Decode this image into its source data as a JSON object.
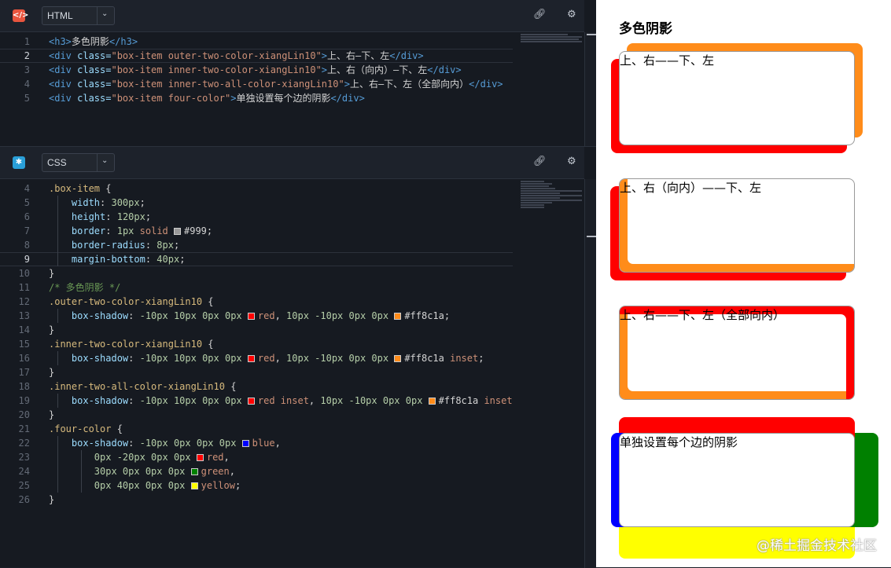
{
  "html_pane": {
    "logo": "</>",
    "language": "HTML",
    "active_line": 2,
    "lines": [
      {
        "n": "1",
        "parts": [
          [
            "tag",
            "<h3>"
          ],
          [
            "plain",
            "多色阴影"
          ],
          [
            "tag",
            "</h3>"
          ]
        ]
      },
      {
        "n": "2",
        "parts": [
          [
            "tag",
            "<div "
          ],
          [
            "attr",
            "class="
          ],
          [
            "str",
            "\"box-item outer-two-color-xiangLin10\""
          ],
          [
            "tag",
            ">"
          ],
          [
            "plain",
            "上、右—下、左"
          ],
          [
            "tag",
            "</div>"
          ]
        ]
      },
      {
        "n": "3",
        "parts": [
          [
            "tag",
            "<div "
          ],
          [
            "attr",
            "class="
          ],
          [
            "str",
            "\"box-item inner-two-color-xiangLin10\""
          ],
          [
            "tag",
            ">"
          ],
          [
            "plain",
            "上、右（向内）—下、左"
          ],
          [
            "tag",
            "</div>"
          ]
        ]
      },
      {
        "n": "4",
        "parts": [
          [
            "tag",
            "<div "
          ],
          [
            "attr",
            "class="
          ],
          [
            "str",
            "\"box-item inner-two-all-color-xiangLin10\""
          ],
          [
            "tag",
            ">"
          ],
          [
            "plain",
            "上、右—下、左（全部向内）"
          ],
          [
            "tag",
            "</div>"
          ]
        ]
      },
      {
        "n": "5",
        "parts": [
          [
            "tag",
            "<div "
          ],
          [
            "attr",
            "class="
          ],
          [
            "str",
            "\"box-item four-color\""
          ],
          [
            "tag",
            ">"
          ],
          [
            "plain",
            "单独设置每个边的阴影"
          ],
          [
            "tag",
            "</div>"
          ]
        ]
      }
    ]
  },
  "css_pane": {
    "logo": "✱",
    "language": "CSS",
    "active_line": 9,
    "lines": [
      {
        "n": "4",
        "parts": [
          [
            "sel",
            ".box-item"
          ],
          [
            "plain",
            " {"
          ]
        ]
      },
      {
        "n": "5",
        "parts": [
          [
            "plain",
            "    "
          ],
          [
            "prop",
            "width"
          ],
          [
            "plain",
            ": "
          ],
          [
            "num",
            "300px"
          ],
          [
            "plain",
            ";"
          ]
        ]
      },
      {
        "n": "6",
        "parts": [
          [
            "plain",
            "    "
          ],
          [
            "prop",
            "height"
          ],
          [
            "plain",
            ": "
          ],
          [
            "num",
            "120px"
          ],
          [
            "plain",
            ";"
          ]
        ]
      },
      {
        "n": "7",
        "parts": [
          [
            "plain",
            "    "
          ],
          [
            "prop",
            "border"
          ],
          [
            "plain",
            ": "
          ],
          [
            "num",
            "1px"
          ],
          [
            "plain",
            " "
          ],
          [
            "kw",
            "solid"
          ],
          [
            "plain",
            " "
          ],
          [
            "sw",
            "#999999"
          ],
          [
            "plain",
            "#999;"
          ]
        ]
      },
      {
        "n": "8",
        "parts": [
          [
            "plain",
            "    "
          ],
          [
            "prop",
            "border-radius"
          ],
          [
            "plain",
            ": "
          ],
          [
            "num",
            "8px"
          ],
          [
            "plain",
            ";"
          ]
        ]
      },
      {
        "n": "9",
        "parts": [
          [
            "plain",
            "    "
          ],
          [
            "prop",
            "margin-bottom"
          ],
          [
            "plain",
            ": "
          ],
          [
            "num",
            "40px"
          ],
          [
            "plain",
            ";"
          ]
        ]
      },
      {
        "n": "10",
        "parts": [
          [
            "plain",
            "}"
          ]
        ]
      },
      {
        "n": "11",
        "parts": [
          [
            "cmt",
            "/* 多色阴影 */"
          ]
        ]
      },
      {
        "n": "12",
        "parts": [
          [
            "sel",
            ".outer-two-color-xiangLin10"
          ],
          [
            "plain",
            " {"
          ]
        ]
      },
      {
        "n": "13",
        "parts": [
          [
            "plain",
            "    "
          ],
          [
            "prop",
            "box-shadow"
          ],
          [
            "plain",
            ": "
          ],
          [
            "num",
            "-10px 10px 0px 0px"
          ],
          [
            "plain",
            " "
          ],
          [
            "sw",
            "#ff0000"
          ],
          [
            "kw",
            "red"
          ],
          [
            "plain",
            ", "
          ],
          [
            "num",
            "10px -10px 0px 0px"
          ],
          [
            "plain",
            " "
          ],
          [
            "sw",
            "#ff8c1a"
          ],
          [
            "plain",
            "#ff8c1a;"
          ]
        ]
      },
      {
        "n": "14",
        "parts": [
          [
            "plain",
            "}"
          ]
        ]
      },
      {
        "n": "15",
        "parts": [
          [
            "sel",
            ".inner-two-color-xiangLin10"
          ],
          [
            "plain",
            " {"
          ]
        ]
      },
      {
        "n": "16",
        "parts": [
          [
            "plain",
            "    "
          ],
          [
            "prop",
            "box-shadow"
          ],
          [
            "plain",
            ": "
          ],
          [
            "num",
            "-10px 10px 0px 0px"
          ],
          [
            "plain",
            " "
          ],
          [
            "sw",
            "#ff0000"
          ],
          [
            "kw",
            "red"
          ],
          [
            "plain",
            ", "
          ],
          [
            "num",
            "10px -10px 0px 0px"
          ],
          [
            "plain",
            " "
          ],
          [
            "sw",
            "#ff8c1a"
          ],
          [
            "plain",
            "#ff8c1a "
          ],
          [
            "kw",
            "inset"
          ],
          [
            "plain",
            ";"
          ]
        ]
      },
      {
        "n": "17",
        "parts": [
          [
            "plain",
            "}"
          ]
        ]
      },
      {
        "n": "18",
        "parts": [
          [
            "sel",
            ".inner-two-all-color-xiangLin10"
          ],
          [
            "plain",
            " {"
          ]
        ]
      },
      {
        "n": "19",
        "parts": [
          [
            "plain",
            "    "
          ],
          [
            "prop",
            "box-shadow"
          ],
          [
            "plain",
            ": "
          ],
          [
            "num",
            "-10px 10px 0px 0px"
          ],
          [
            "plain",
            " "
          ],
          [
            "sw",
            "#ff0000"
          ],
          [
            "kw",
            "red inset"
          ],
          [
            "plain",
            ", "
          ],
          [
            "num",
            "10px -10px 0px 0px"
          ],
          [
            "plain",
            " "
          ],
          [
            "sw",
            "#ff8c1a"
          ],
          [
            "plain",
            "#ff8c1a "
          ],
          [
            "kw",
            "inset"
          ]
        ]
      },
      {
        "n": "20",
        "parts": [
          [
            "plain",
            "}"
          ]
        ]
      },
      {
        "n": "21",
        "parts": [
          [
            "sel",
            ".four-color"
          ],
          [
            "plain",
            " {"
          ]
        ]
      },
      {
        "n": "22",
        "parts": [
          [
            "plain",
            "    "
          ],
          [
            "prop",
            "box-shadow"
          ],
          [
            "plain",
            ": "
          ],
          [
            "num",
            "-10px 0px 0px 0px"
          ],
          [
            "plain",
            " "
          ],
          [
            "sw",
            "#0000ff"
          ],
          [
            "kw",
            "blue"
          ],
          [
            "plain",
            ","
          ]
        ]
      },
      {
        "n": "23",
        "parts": [
          [
            "plain",
            "        "
          ],
          [
            "num",
            "0px -20px 0px 0px"
          ],
          [
            "plain",
            " "
          ],
          [
            "sw",
            "#ff0000"
          ],
          [
            "kw",
            "red"
          ],
          [
            "plain",
            ","
          ]
        ]
      },
      {
        "n": "24",
        "parts": [
          [
            "plain",
            "        "
          ],
          [
            "num",
            "30px 0px 0px 0px"
          ],
          [
            "plain",
            " "
          ],
          [
            "sw",
            "#008000"
          ],
          [
            "kw",
            "green"
          ],
          [
            "plain",
            ","
          ]
        ]
      },
      {
        "n": "25",
        "parts": [
          [
            "plain",
            "        "
          ],
          [
            "num",
            "0px 40px 0px 0px"
          ],
          [
            "plain",
            " "
          ],
          [
            "sw",
            "#ffff00"
          ],
          [
            "kw",
            "yellow"
          ],
          [
            "plain",
            ";"
          ]
        ]
      },
      {
        "n": "26",
        "parts": [
          [
            "plain",
            "}"
          ]
        ]
      }
    ]
  },
  "preview": {
    "title": "多色阴影",
    "boxes": [
      {
        "label": "上、右——下、左"
      },
      {
        "label": "上、右（向内）——下、左"
      },
      {
        "label": "上、右——下、左（全部向内）"
      },
      {
        "label": "单独设置每个边的阴影"
      }
    ],
    "watermark": "@稀土掘金技术社区"
  },
  "colors": {
    "red": "#ff0000",
    "orange": "#ff8c1a",
    "blue": "#0000ff",
    "green": "#008000",
    "yellow": "#ffff00"
  }
}
